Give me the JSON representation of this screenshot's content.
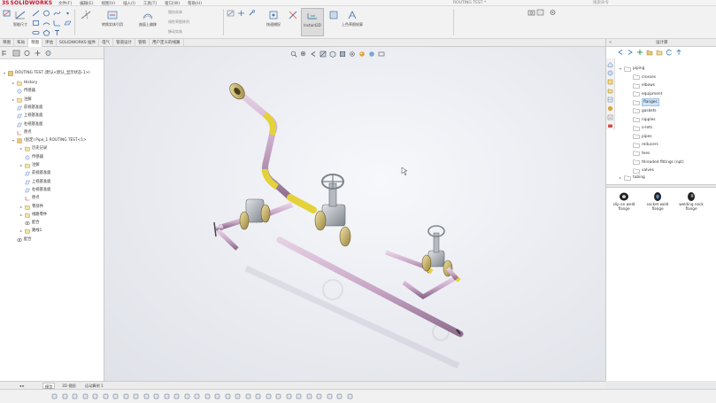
{
  "app": {
    "brand_ds": "3S",
    "brand_name": "SOLIDWORKS"
  },
  "menus": [
    "文件(F)",
    "编辑(E)",
    "视图(V)",
    "插入(I)",
    "工具(T)",
    "窗口(W)",
    "帮助(H)"
  ],
  "title": {
    "document": "ROUTING TEST *",
    "search_placeholder": "搜索命令"
  },
  "command_manager": {
    "smart_dim": "智能尺寸",
    "convert_entities": "转换实体引用",
    "offset_on_surface": "曲面上偏移",
    "quick_snap": "快速捕捉",
    "instant2d": "Instant2D",
    "rapid_sketch": "上色草图轮廓",
    "repair_sketch": "修复草图",
    "show_hide": "显示/删除几何关系",
    "mirror": "镜向实体",
    "linear_pattern": "线性草图阵列",
    "move_entities": "移动实体"
  },
  "tabs": [
    {
      "label": "草图",
      "active": false
    },
    {
      "label": "布局",
      "active": false
    },
    {
      "label": "草图",
      "active": true
    },
    {
      "label": "评估",
      "active": false
    },
    {
      "label": "SOLIDWORKS 插件",
      "active": false
    },
    {
      "label": "电气",
      "active": false
    },
    {
      "label": "管道设计",
      "active": false
    },
    {
      "label": "管筒",
      "active": false
    },
    {
      "label": "用户定义的线路",
      "active": false
    }
  ],
  "tree": {
    "root": "ROUTING TEST (默认<默认_显示状态-1>)",
    "items": [
      {
        "label": "History",
        "indent": 1,
        "exp": "▸"
      },
      {
        "label": "传感器",
        "indent": 1,
        "exp": ""
      },
      {
        "label": "注解",
        "indent": 1,
        "exp": "▸"
      },
      {
        "label": "前视基准面",
        "indent": 1,
        "exp": ""
      },
      {
        "label": "上视基准面",
        "indent": 1,
        "exp": ""
      },
      {
        "label": "右视基准面",
        "indent": 1,
        "exp": ""
      },
      {
        "label": "原点",
        "indent": 1,
        "exp": ""
      },
      {
        "label": "(固定) Pipe_1 ROUTING TEST<1>",
        "indent": 1,
        "exp": "▾"
      },
      {
        "label": "历史记录",
        "indent": 2,
        "exp": "▸"
      },
      {
        "label": "传感器",
        "indent": 2,
        "exp": ""
      },
      {
        "label": "注解",
        "indent": 2,
        "exp": "▸"
      },
      {
        "label": "前视基准面",
        "indent": 2,
        "exp": ""
      },
      {
        "label": "上视基准面",
        "indent": 2,
        "exp": ""
      },
      {
        "label": "右视基准面",
        "indent": 2,
        "exp": ""
      },
      {
        "label": "原点",
        "indent": 2,
        "exp": ""
      },
      {
        "label": "零部件",
        "indent": 2,
        "exp": "▸"
      },
      {
        "label": "线路零件",
        "indent": 2,
        "exp": "▸"
      },
      {
        "label": "配合",
        "indent": 2,
        "exp": ""
      },
      {
        "label": "路线1",
        "indent": 2,
        "exp": "▸"
      },
      {
        "label": "配合",
        "indent": 1,
        "exp": ""
      }
    ]
  },
  "library": {
    "title": "设计库",
    "root": "piping",
    "items": [
      "crosses",
      "elbows",
      "equipment",
      "flanges",
      "gaskets",
      "nipples",
      "o-lets",
      "pipes",
      "reducers",
      "tees",
      "threaded fittings (npt)",
      "valves"
    ],
    "selected": "flanges",
    "sibling": "tubing",
    "parts": [
      "slip on weld flange",
      "socket weld flange",
      "welding neck flange"
    ]
  },
  "bottom_tabs": [
    "模型",
    "3D 视图",
    "运动算例 1"
  ],
  "colors": {
    "pipe": "#c9a8c8",
    "elbow": "#e4d23a",
    "flange": "#c8b56a",
    "valve": "#9fa4ab",
    "selection": "#cfe3f7"
  }
}
